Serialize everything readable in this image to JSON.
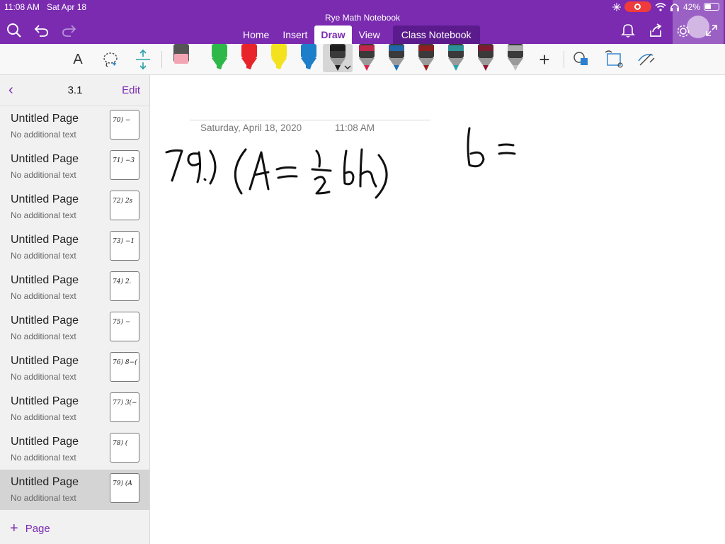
{
  "status": {
    "time": "11:08 AM",
    "date": "Sat Apr 18",
    "battery": "42%",
    "battery_level": 0.42
  },
  "app": {
    "notebook_title": "Rye Math Notebook"
  },
  "tabs": [
    {
      "label": "Home"
    },
    {
      "label": "Insert"
    },
    {
      "label": "Draw",
      "active": true
    },
    {
      "label": "View"
    },
    {
      "label": "Class Notebook"
    }
  ],
  "header_icons": [
    "search-icon",
    "undo-icon",
    "redo-icon",
    "bell-icon",
    "share-icon",
    "gear-icon",
    "expand-icon"
  ],
  "ribbon": {
    "type_tool_label": "A",
    "pens": [
      {
        "name": "eraser",
        "color": "#f2a6b4"
      },
      {
        "name": "green-highlighter",
        "color": "#2fb84a"
      },
      {
        "name": "red-highlighter",
        "color": "#e8242a"
      },
      {
        "name": "yellow-highlighter",
        "color": "#f4e21e"
      },
      {
        "name": "blue-highlighter",
        "color": "#1d7ec9"
      },
      {
        "name": "black-pen",
        "color": "#1a1a1a",
        "selected": true
      },
      {
        "name": "pink-pen",
        "color": "#d9234f"
      },
      {
        "name": "blue-pen",
        "color": "#1e6fb8"
      },
      {
        "name": "dark-red-pen",
        "color": "#9b1b1b"
      },
      {
        "name": "teal-galaxy-pen",
        "color": "#2aa1a8"
      },
      {
        "name": "maroon-pen",
        "color": "#8a1630"
      },
      {
        "name": "silver-pen",
        "color": "#c0c0c0"
      }
    ],
    "add_label": "+"
  },
  "colors": {
    "accent": "#7a2bb0",
    "accent_dark": "#5b1b8c"
  },
  "sidebar": {
    "section_name": "3.1",
    "edit_label": "Edit",
    "add_page_label": "Page",
    "pages": [
      {
        "title": "Untitled Page",
        "subtitle": "No additional text",
        "thumb": "70) −"
      },
      {
        "title": "Untitled Page",
        "subtitle": "No additional text",
        "thumb": "71) −3"
      },
      {
        "title": "Untitled Page",
        "subtitle": "No additional text",
        "thumb": "72) 2s"
      },
      {
        "title": "Untitled Page",
        "subtitle": "No additional text",
        "thumb": "73) −1"
      },
      {
        "title": "Untitled Page",
        "subtitle": "No additional text",
        "thumb": "74) 2."
      },
      {
        "title": "Untitled Page",
        "subtitle": "No additional text",
        "thumb": "75) −"
      },
      {
        "title": "Untitled Page",
        "subtitle": "No additional text",
        "thumb": "76) 8−("
      },
      {
        "title": "Untitled Page",
        "subtitle": "No additional text",
        "thumb": "77) 3(−"
      },
      {
        "title": "Untitled Page",
        "subtitle": "No additional text",
        "thumb": "78) ("
      },
      {
        "title": "Untitled Page",
        "subtitle": "No additional text",
        "thumb": "79) (A",
        "selected": true
      }
    ]
  },
  "page": {
    "date": "Saturday, April 18, 2020",
    "time": "11:08 AM"
  }
}
